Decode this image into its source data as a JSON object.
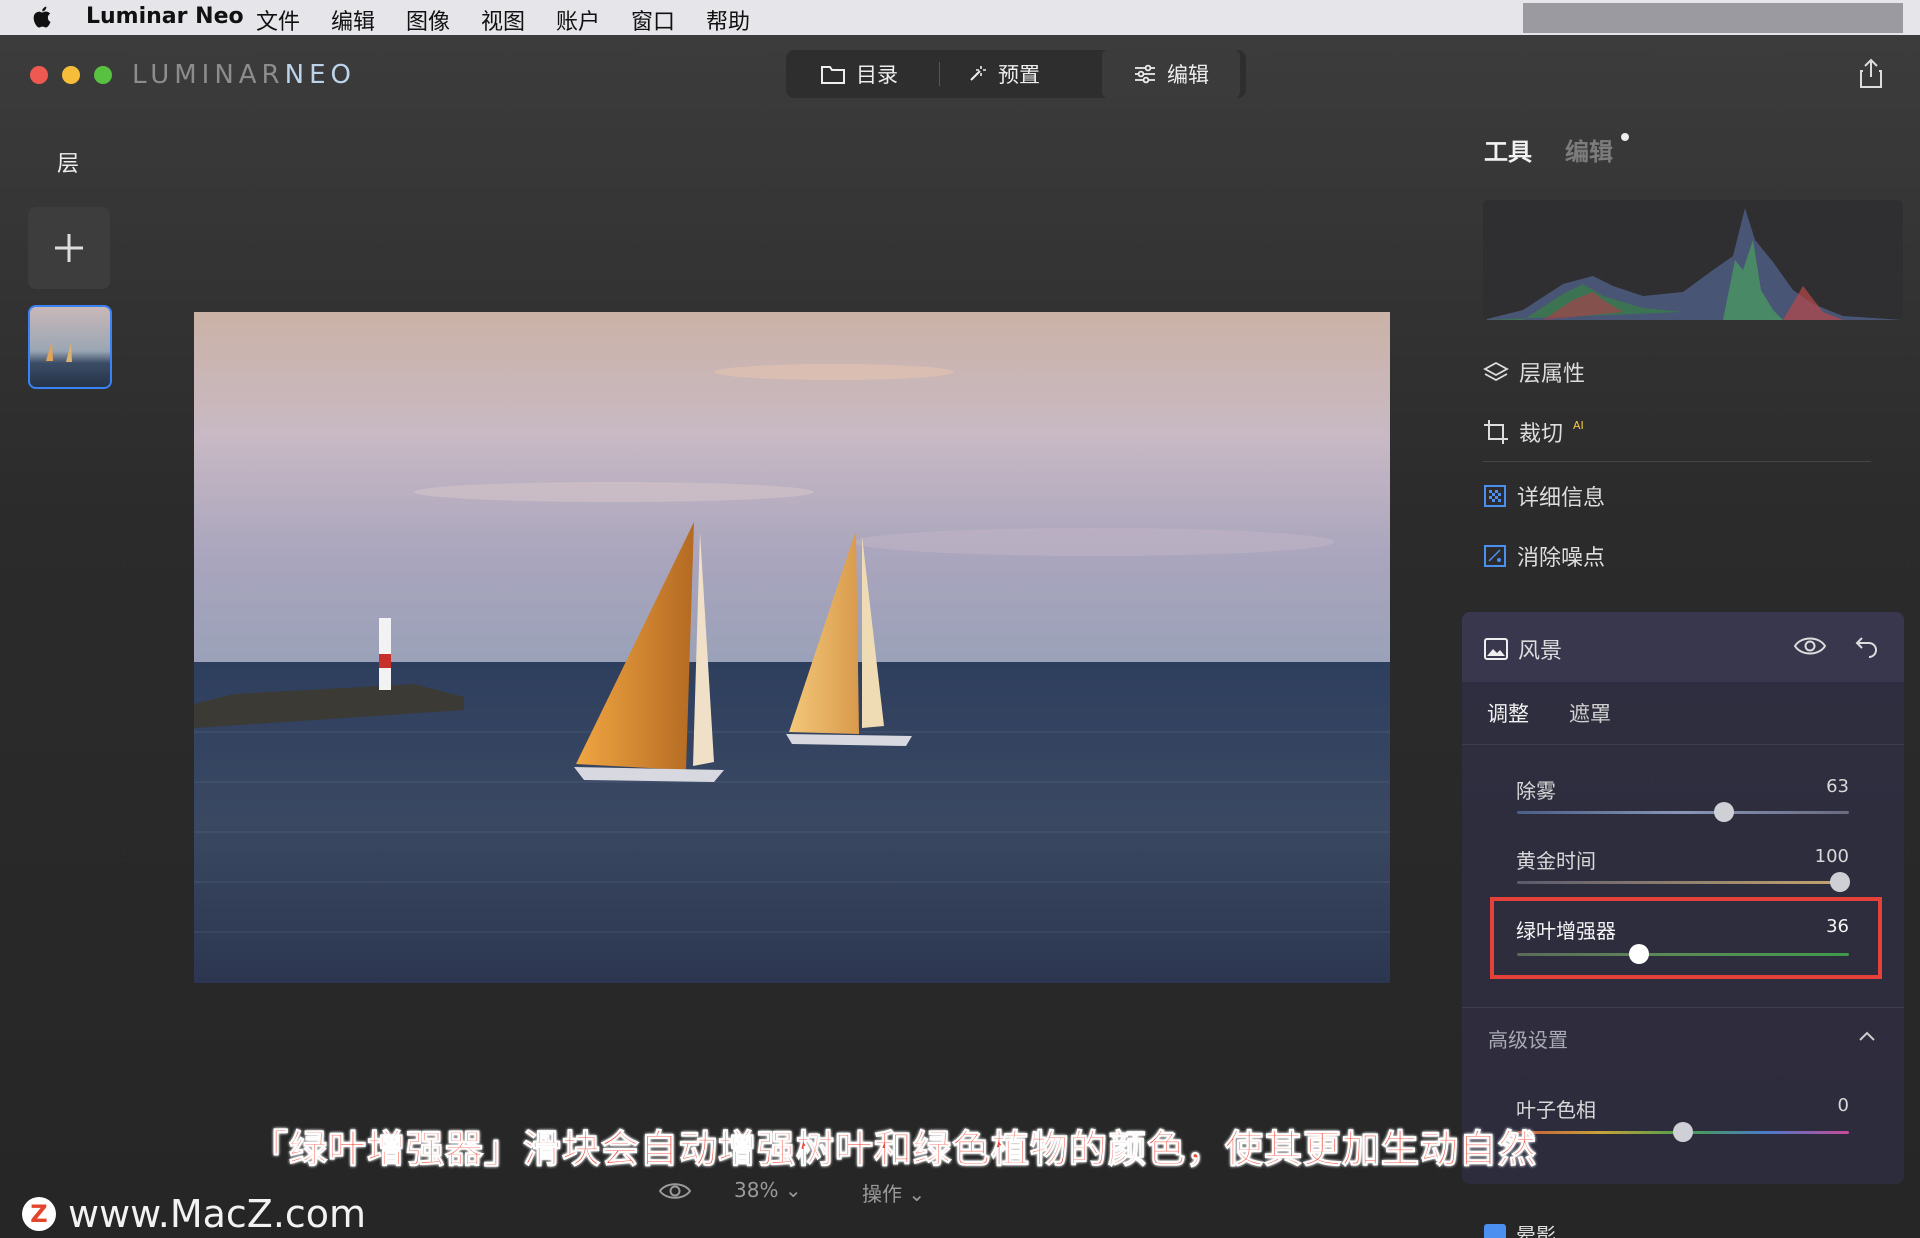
{
  "menubar": {
    "app_name": "Luminar Neo",
    "items": [
      "文件",
      "编辑",
      "图像",
      "视图",
      "账户",
      "窗口",
      "帮助"
    ]
  },
  "window": {
    "brand_main": "LUMINAR",
    "brand_accent": "NEO",
    "nav": {
      "catalog": "目录",
      "presets": "预置",
      "edit": "编辑"
    }
  },
  "layers": {
    "title": "层"
  },
  "bottombar": {
    "zoom": "38%",
    "actions": "操作"
  },
  "right_panel": {
    "tab_tools": "工具",
    "tab_edits": "编辑",
    "tools": {
      "layer_properties": "层属性",
      "crop": "裁切",
      "crop_badge": "AI",
      "details": "详细信息",
      "denoise": "消除噪点"
    },
    "landscape": {
      "title": "风景",
      "tab_adjust": "调整",
      "tab_mask": "遮罩",
      "sliders": [
        {
          "label": "除雾",
          "value": "63",
          "fraction": 0.63
        },
        {
          "label": "黄金时间",
          "value": "100",
          "fraction": 1.0
        },
        {
          "label": "绿叶增强器",
          "value": "36",
          "fraction": 0.36
        }
      ],
      "advanced": "高级设置",
      "leaf_hue": {
        "label": "叶子色相",
        "value": "0",
        "fraction": 0.5
      }
    },
    "next_tool_partial": "晕影"
  },
  "caption": "「绿叶增强器」滑块会自动增强树叶和绿色植物的颜色，使其更加生动自然",
  "watermark": {
    "logo": "Z",
    "text": "www.MacZ.com"
  },
  "colors": {
    "accent": "#3b82f6",
    "highlight": "#e5413a",
    "caption": "#f04a3a"
  }
}
